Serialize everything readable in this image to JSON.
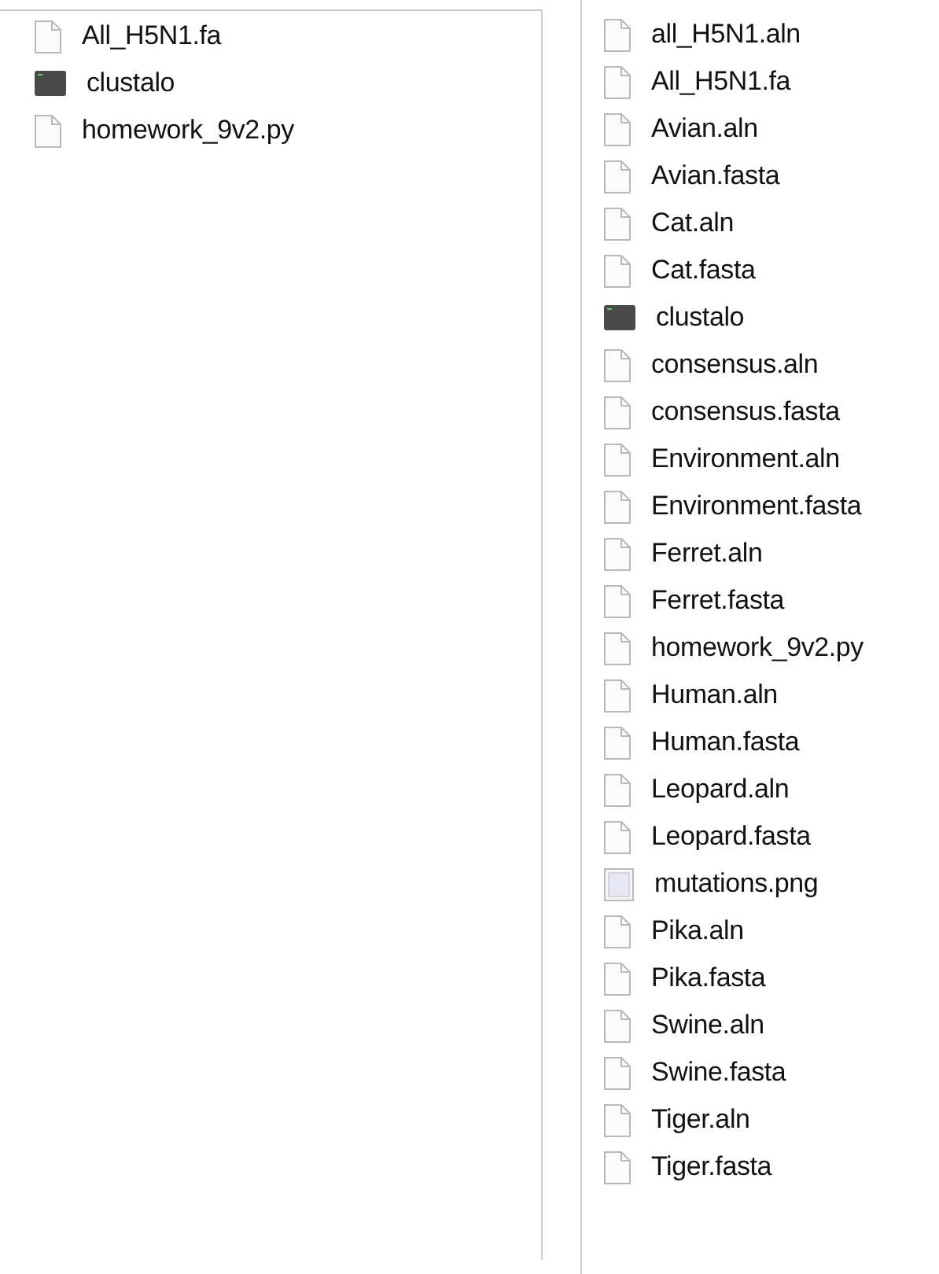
{
  "left_pane": {
    "files": [
      {
        "name": "All_H5N1.fa",
        "kind": "document"
      },
      {
        "name": "clustalo",
        "kind": "executable"
      },
      {
        "name": "homework_9v2.py",
        "kind": "document"
      }
    ]
  },
  "right_pane": {
    "files": [
      {
        "name": "all_H5N1.aln",
        "kind": "document"
      },
      {
        "name": "All_H5N1.fa",
        "kind": "document"
      },
      {
        "name": "Avian.aln",
        "kind": "document"
      },
      {
        "name": "Avian.fasta",
        "kind": "document"
      },
      {
        "name": "Cat.aln",
        "kind": "document"
      },
      {
        "name": "Cat.fasta",
        "kind": "document"
      },
      {
        "name": "clustalo",
        "kind": "executable"
      },
      {
        "name": "consensus.aln",
        "kind": "document"
      },
      {
        "name": "consensus.fasta",
        "kind": "document"
      },
      {
        "name": "Environment.aln",
        "kind": "document"
      },
      {
        "name": "Environment.fasta",
        "kind": "document"
      },
      {
        "name": "Ferret.aln",
        "kind": "document"
      },
      {
        "name": "Ferret.fasta",
        "kind": "document"
      },
      {
        "name": "homework_9v2.py",
        "kind": "document"
      },
      {
        "name": "Human.aln",
        "kind": "document"
      },
      {
        "name": "Human.fasta",
        "kind": "document"
      },
      {
        "name": "Leopard.aln",
        "kind": "document"
      },
      {
        "name": "Leopard.fasta",
        "kind": "document"
      },
      {
        "name": "mutations.png",
        "kind": "image"
      },
      {
        "name": "Pika.aln",
        "kind": "document"
      },
      {
        "name": "Pika.fasta",
        "kind": "document"
      },
      {
        "name": "Swine.aln",
        "kind": "document"
      },
      {
        "name": "Swine.fasta",
        "kind": "document"
      },
      {
        "name": "Tiger.aln",
        "kind": "document"
      },
      {
        "name": "Tiger.fasta",
        "kind": "document"
      }
    ]
  }
}
